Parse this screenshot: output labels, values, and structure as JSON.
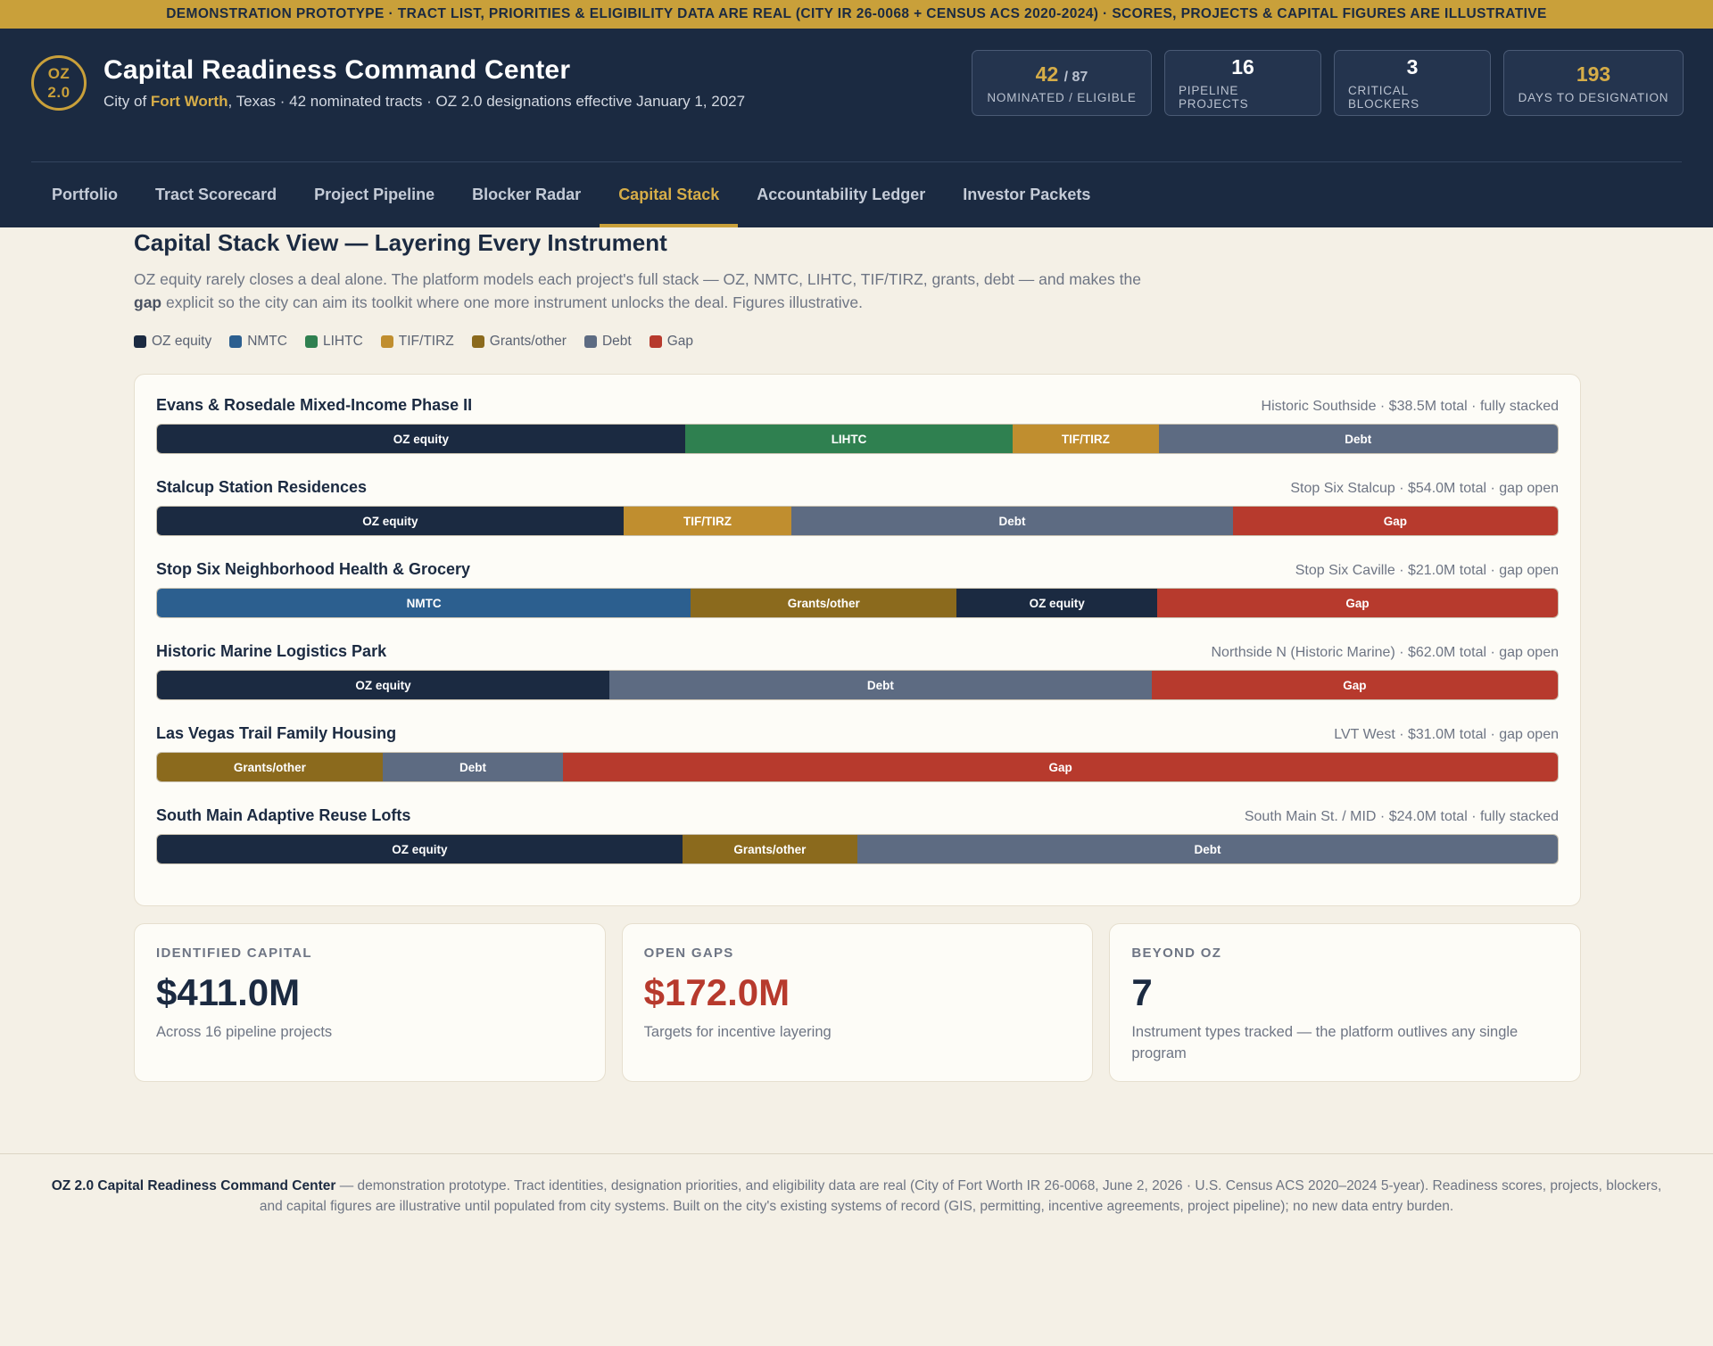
{
  "banner": "DEMONSTRATION PROTOTYPE · TRACT LIST, PRIORITIES & ELIGIBILITY DATA ARE REAL (CITY IR 26-0068 + CENSUS ACS 2020-2024) · SCORES, PROJECTS & CAPITAL FIGURES ARE ILLUSTRATIVE",
  "header": {
    "logo_line1": "OZ",
    "logo_line2": "2.0",
    "title": "Capital Readiness Command Center",
    "subtitle_prefix": "City of ",
    "subtitle_city": "Fort Worth",
    "subtitle_rest": ", Texas · 42 nominated tracts · OZ 2.0 designations effective January 1, 2027",
    "kpis": [
      {
        "value": "42",
        "of": "/ 87",
        "label": "NOMINATED / ELIGIBLE"
      },
      {
        "value": "16",
        "label": "PIPELINE PROJECTS"
      },
      {
        "value": "3",
        "label": "CRITICAL BLOCKERS"
      },
      {
        "value": "193",
        "label": "DAYS TO DESIGNATION"
      }
    ]
  },
  "nav": {
    "tabs": [
      "Portfolio",
      "Tract Scorecard",
      "Project Pipeline",
      "Blocker Radar",
      "Capital Stack",
      "Accountability Ledger",
      "Investor Packets"
    ],
    "active": "Capital Stack"
  },
  "page": {
    "title": "Capital Stack View — Layering Every Instrument",
    "desc_part1": "OZ equity rarely closes a deal alone. The platform models each project's full stack — OZ, NMTC, LIHTC, TIF/TIRZ, grants, debt — and makes the ",
    "desc_bold": "gap",
    "desc_part2": " explicit so the city can aim its toolkit where one more instrument unlocks the deal. Figures illustrative."
  },
  "legend": [
    {
      "label": "OZ equity",
      "color": "#1b2a41"
    },
    {
      "label": "NMTC",
      "color": "#2c5f8f"
    },
    {
      "label": "LIHTC",
      "color": "#2f8050"
    },
    {
      "label": "TIF/TIRZ",
      "color": "#c08e2f"
    },
    {
      "label": "Grants/other",
      "color": "#8b6a1d"
    },
    {
      "label": "Debt",
      "color": "#5d6b82"
    },
    {
      "label": "Gap",
      "color": "#b73a2d"
    }
  ],
  "projects": [
    {
      "name": "Evans & Rosedale Mixed-Income Phase II",
      "meta": "Historic Southside · $38.5M total · fully stacked",
      "segments": [
        {
          "label": "OZ equity",
          "share": 37.7
        },
        {
          "label": "LIHTC",
          "share": 23.4
        },
        {
          "label": "TIF/TIRZ",
          "share": 10.4
        },
        {
          "label": "Debt",
          "share": 28.5
        }
      ]
    },
    {
      "name": "Stalcup Station Residences",
      "meta": "Stop Six Stalcup · $54.0M total · gap open",
      "segments": [
        {
          "label": "OZ equity",
          "share": 33.3
        },
        {
          "label": "TIF/TIRZ",
          "share": 12.0
        },
        {
          "label": "Debt",
          "share": 31.5
        },
        {
          "label": "Gap",
          "share": 23.2
        }
      ]
    },
    {
      "name": "Stop Six Neighborhood Health & Grocery",
      "meta": "Stop Six Caville · $21.0M total · gap open",
      "segments": [
        {
          "label": "NMTC",
          "share": 38.1
        },
        {
          "label": "Grants/other",
          "share": 19.0
        },
        {
          "label": "OZ equity",
          "share": 14.3
        },
        {
          "label": "Gap",
          "share": 28.6
        }
      ]
    },
    {
      "name": "Historic Marine Logistics Park",
      "meta": "Northside N (Historic Marine) · $62.0M total · gap open",
      "segments": [
        {
          "label": "OZ equity",
          "share": 32.3
        },
        {
          "label": "Debt",
          "share": 38.7
        },
        {
          "label": "Gap",
          "share": 29.0
        }
      ]
    },
    {
      "name": "Las Vegas Trail Family Housing",
      "meta": "LVT West · $31.0M total · gap open",
      "segments": [
        {
          "label": "Grants/other",
          "share": 16.1
        },
        {
          "label": "Debt",
          "share": 12.9
        },
        {
          "label": "Gap",
          "share": 71.0
        }
      ]
    },
    {
      "name": "South Main Adaptive Reuse Lofts",
      "meta": "South Main St. / MID · $24.0M total · fully stacked",
      "segments": [
        {
          "label": "OZ equity",
          "share": 37.5
        },
        {
          "label": "Grants/other",
          "share": 12.5
        },
        {
          "label": "Debt",
          "share": 50.0
        }
      ]
    }
  ],
  "summary": [
    {
      "label": "IDENTIFIED CAPITAL",
      "value": "$411.0M",
      "note": "Across 16 pipeline projects"
    },
    {
      "label": "OPEN GAPS",
      "value": "$172.0M",
      "note": "Targets for incentive layering"
    },
    {
      "label": "BEYOND OZ",
      "value": "7",
      "note": "Instrument types tracked — the platform outlives any single program"
    }
  ],
  "footer": {
    "bold": "OZ 2.0 Capital Readiness Command Center",
    "text": " — demonstration prototype. Tract identities, designation priorities, and eligibility data are real (City of Fort Worth IR 26-0068, June 2, 2026 · U.S. Census ACS 2020–2024 5-year). Readiness scores, projects, blockers, and capital figures are illustrative until populated from city systems. Built on the city's existing systems of record (GIS, permitting, incentive agreements, project pipeline); no new data entry burden."
  }
}
